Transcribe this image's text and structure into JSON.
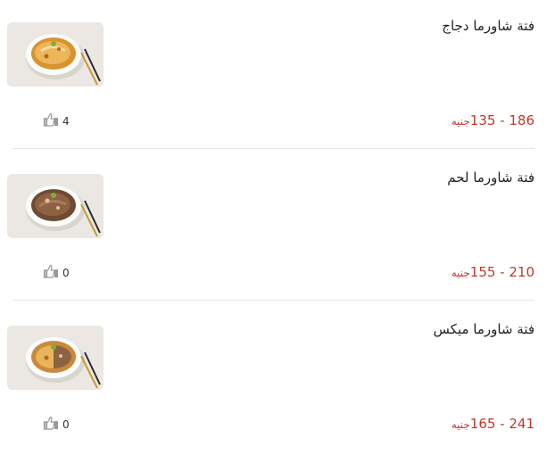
{
  "items": [
    {
      "title": "فتة شاورما دجاج",
      "price_range": "135 - 186",
      "currency": "جنيه",
      "likes": "4",
      "dish": "chicken"
    },
    {
      "title": "فتة شاورما لحم",
      "price_range": "155 - 210",
      "currency": "جنيه",
      "likes": "0",
      "dish": "beef"
    },
    {
      "title": "فتة شاورما ميكس",
      "price_range": "165 - 241",
      "currency": "جنيه",
      "likes": "0",
      "dish": "mix"
    }
  ],
  "colors": {
    "price": "#c0392b",
    "separator": "#e6e6e6"
  },
  "icons": {
    "like": "thumbs-up-icon"
  }
}
